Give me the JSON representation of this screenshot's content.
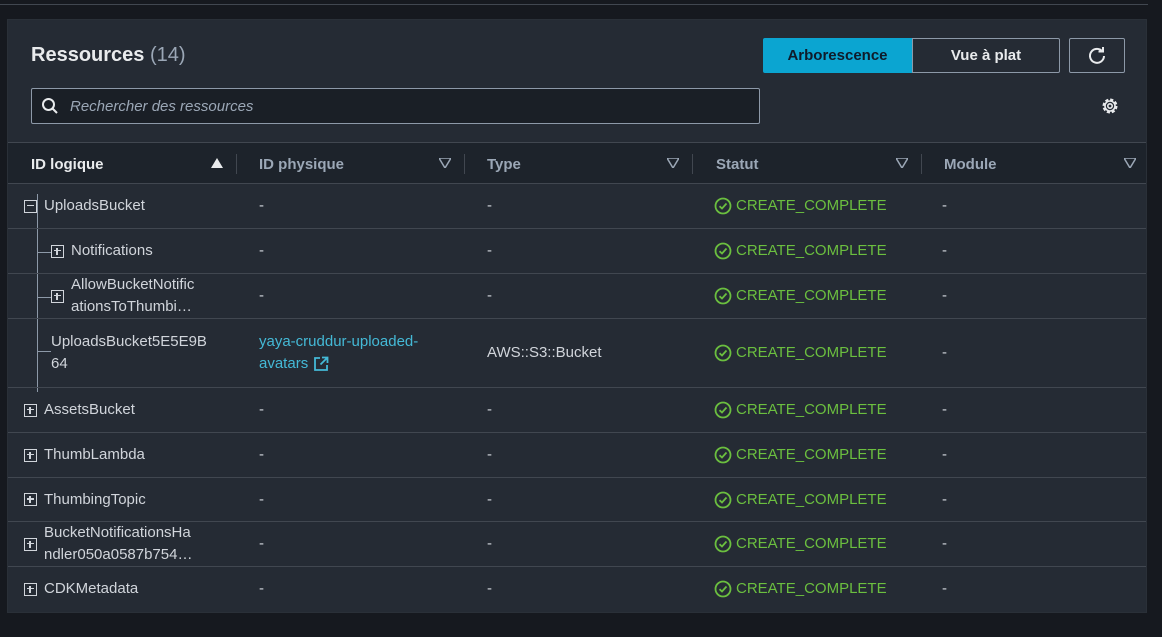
{
  "header": {
    "title": "Ressources",
    "count": "(14)"
  },
  "view_toggle": {
    "tree_label": "Arborescence",
    "flat_label": "Vue à plat"
  },
  "search": {
    "placeholder": "Rechercher des ressources",
    "value": ""
  },
  "columns": [
    {
      "label": "ID logique"
    },
    {
      "label": "ID physique"
    },
    {
      "label": "Type"
    },
    {
      "label": "Statut"
    },
    {
      "label": "Module"
    }
  ],
  "rows": [
    {
      "logical_id": "UploadsBucket",
      "physical_id": "-",
      "type": "-",
      "status": "CREATE_COMPLETE",
      "module": "-"
    },
    {
      "logical_id": "Notifications",
      "physical_id": "-",
      "type": "-",
      "status": "CREATE_COMPLETE",
      "module": "-"
    },
    {
      "logical_id_line1": "AllowBucketNotific",
      "logical_id_line2": "ationsToThumbi…",
      "physical_id": "-",
      "type": "-",
      "status": "CREATE_COMPLETE",
      "module": "-"
    },
    {
      "logical_id_line1": "UploadsBucket5E5E9B",
      "logical_id_line2": "64",
      "physical_id_line1": "yaya-cruddur-uploaded-",
      "physical_id_line2": "avatars",
      "type": "AWS::S3::Bucket",
      "status": "CREATE_COMPLETE",
      "module": "-"
    },
    {
      "logical_id": "AssetsBucket",
      "physical_id": "-",
      "type": "-",
      "status": "CREATE_COMPLETE",
      "module": "-"
    },
    {
      "logical_id": "ThumbLambda",
      "physical_id": "-",
      "type": "-",
      "status": "CREATE_COMPLETE",
      "module": "-"
    },
    {
      "logical_id": "ThumbingTopic",
      "physical_id": "-",
      "type": "-",
      "status": "CREATE_COMPLETE",
      "module": "-"
    },
    {
      "logical_id_line1": "BucketNotificationsHa",
      "logical_id_line2": "ndler050a0587b754…",
      "physical_id": "-",
      "type": "-",
      "status": "CREATE_COMPLETE",
      "module": "-"
    },
    {
      "logical_id": "CDKMetadata",
      "physical_id": "-",
      "type": "-",
      "status": "CREATE_COMPLETE",
      "module": "-"
    }
  ],
  "colors": {
    "accent": "#0ba5d1",
    "success": "#6bbf3f",
    "link": "#44b9d6"
  }
}
